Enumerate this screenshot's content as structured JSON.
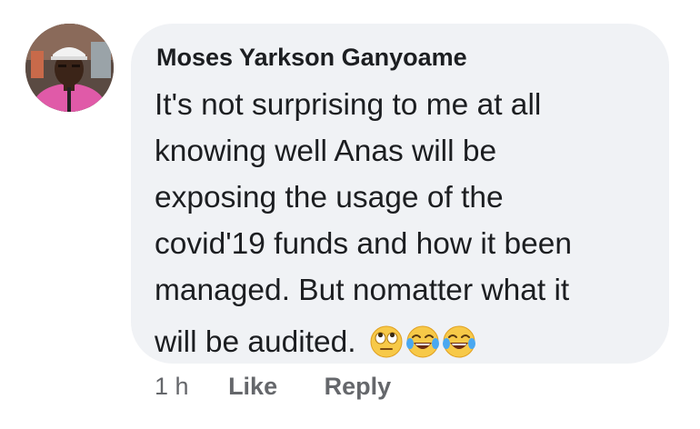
{
  "comment": {
    "author": "Moses Yarkson Ganyoame",
    "lines": [
      "It's not surprising to me at all",
      "knowing well Anas  will be",
      "exposing the usage of the",
      "covid'19 funds and how it been",
      "managed. But nomatter what it",
      "will be audited."
    ],
    "emojis": [
      "face-with-rolling-eyes-icon",
      "face-with-tears-of-joy-icon",
      "face-with-tears-of-joy-icon"
    ]
  },
  "actions": {
    "timestamp": "1 h",
    "like_label": "Like",
    "reply_label": "Reply"
  },
  "colors": {
    "bubble_bg": "#f0f2f5",
    "text": "#1c1e21",
    "meta_text": "#65676b"
  }
}
